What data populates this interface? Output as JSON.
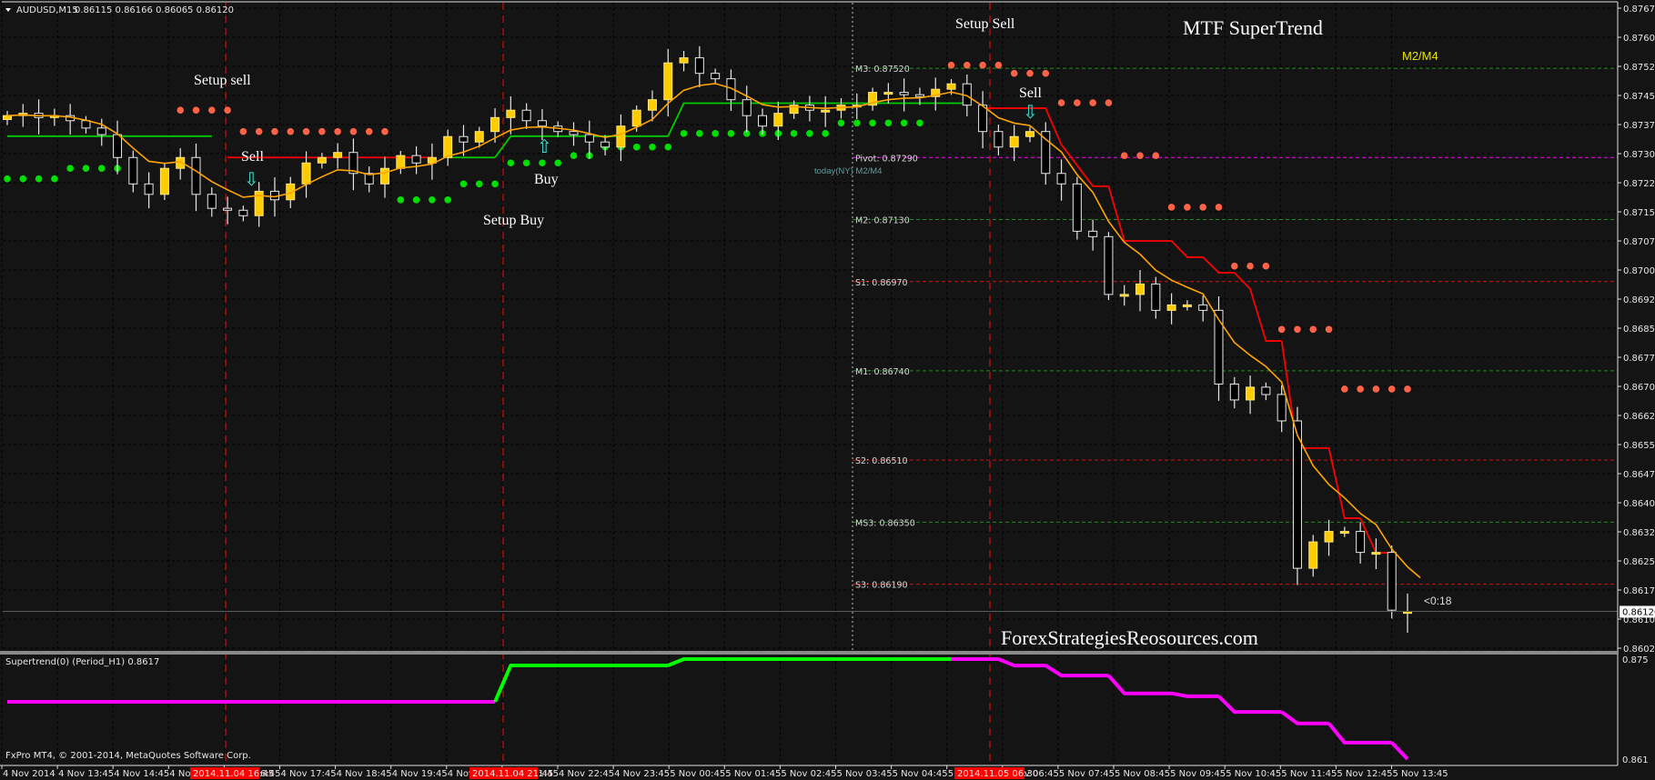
{
  "header": {
    "symbol": "AUDUSD,M15",
    "ohlc": "0.86115 0.86166 0.86065 0.86120"
  },
  "annotations": {
    "setup_sell_1": "Setup sell",
    "sell_1": "Sell",
    "buy_1": "Buy",
    "setup_buy_1": "Setup Buy",
    "setup_sell_2": "Setup Sell",
    "sell_2": "Sell",
    "title": "MTF SuperTrend",
    "m2m4": "M2/M4",
    "today_label": "today(NY) M2/M4",
    "watermark": "ForexStrategiesReosources.com",
    "countdown": "<0:18",
    "copyright": "FxPro MT4, © 2001-2014, MetaQuotes Software Corp."
  },
  "colors": {
    "background": "#141414",
    "bull": "#ffcc00",
    "bear": "#000000",
    "ema": "#ffa500",
    "supertrend_up": "#00cc00",
    "supertrend_down": "#ff0000",
    "dot_up": "#00e000",
    "dot_down": "#ff6347",
    "lower_up": "#00ff00",
    "lower_down": "#ff00ff",
    "arrow": "#40e0d0"
  },
  "price_axis": {
    "labels": [
      "0.87675",
      "0.87600",
      "0.87525",
      "0.87450",
      "0.87375",
      "0.87300",
      "0.87225",
      "0.87150",
      "0.87075",
      "0.87000",
      "0.86925",
      "0.86850",
      "0.86775",
      "0.86700",
      "0.86625",
      "0.86550",
      "0.86475",
      "0.86400",
      "0.86325",
      "0.86250",
      "0.86175",
      "0.86100",
      "0.86025"
    ],
    "current_price": "0.86120"
  },
  "lower_panel": {
    "title": "Supertrend(0) (Period_H1) 0.8617",
    "max_label": "0.875",
    "min_label": "0.861"
  },
  "time_axis": {
    "labels": [
      "4 Nov 2014",
      "4 Nov 13:45",
      "4 Nov 14:45",
      "4 Nov 15:45",
      "4 Nov 16:45",
      "4 Nov 17:45",
      "4 Nov 18:45",
      "4 Nov 19:45",
      "4 Nov 20:45",
      "4 Nov 21:45",
      "4 Nov 22:45",
      "4 Nov 23:45",
      "5 Nov 00:45",
      "5 Nov 01:45",
      "5 Nov 02:45",
      "5 Nov 03:45",
      "5 Nov 04:45",
      "5 Nov 05:45",
      "5 Nov 06:45",
      "5 Nov 07:45",
      "5 Nov 08:45",
      "5 Nov 09:45",
      "5 Nov 10:45",
      "5 Nov 11:45",
      "5 Nov 12:45",
      "5 Nov 13:45"
    ],
    "markers": [
      "2014.11.04 16:45",
      "2014.11.04 21:45",
      "2014.11.05 06:30"
    ]
  },
  "pivots": [
    {
      "label": "M3: 0.87520",
      "value": 0.8752,
      "kind": "m"
    },
    {
      "label": "Pivot: 0.87290",
      "value": 0.8729,
      "kind": "pivot"
    },
    {
      "label": "M2: 0.87130",
      "value": 0.8713,
      "kind": "m"
    },
    {
      "label": "S1: 0.86970",
      "value": 0.8697,
      "kind": "s"
    },
    {
      "label": "M1: 0.86740",
      "value": 0.8674,
      "kind": "m"
    },
    {
      "label": "S2: 0.86510",
      "value": 0.8651,
      "kind": "s"
    },
    {
      "label": "MS3: 0.86350",
      "value": 0.8635,
      "kind": "m"
    },
    {
      "label": "S3: 0.86190",
      "value": 0.8619,
      "kind": "s"
    }
  ],
  "chart_data": {
    "type": "candlestick",
    "title": "AUDUSD,M15",
    "ylim": [
      0.86025,
      0.87675
    ],
    "grid": true,
    "closes": [
      0.87398,
      0.87404,
      0.87393,
      0.87398,
      0.87385,
      0.87366,
      0.87349,
      0.8729,
      0.87222,
      0.87195,
      0.87262,
      0.8729,
      0.87195,
      0.87159,
      0.87154,
      0.8714,
      0.87203,
      0.87181,
      0.87222,
      0.87276,
      0.8729,
      0.87303,
      0.87249,
      0.87222,
      0.87262,
      0.87295,
      0.87276,
      0.8729,
      0.87344,
      0.8733,
      0.87357,
      0.87393,
      0.87412,
      0.87385,
      0.87371,
      0.87357,
      0.87349,
      0.8733,
      0.87317,
      0.87371,
      0.87412,
      0.87439,
      0.87534,
      0.87547,
      0.87507,
      0.87493,
      0.87439,
      0.87398,
      0.87371,
      0.87404,
      0.87425,
      0.87412,
      0.87412,
      0.87425,
      0.87425,
      0.87458,
      0.87458,
      0.87452,
      0.87447,
      0.87466,
      0.8748,
      0.87425,
      0.87357,
      0.87317,
      0.87344,
      0.87357,
      0.87249,
      0.87222,
      0.871,
      0.87086,
      0.86937,
      0.86937,
      0.86964,
      0.86896,
      0.8691,
      0.8691,
      0.86896,
      0.86706,
      0.86665,
      0.86698,
      0.86679,
      0.86611,
      0.86231,
      0.86299,
      0.86326,
      0.86326,
      0.86272,
      0.86272,
      0.86123,
      0.8612
    ],
    "last_bar": {
      "open": 0.86115,
      "high": 0.86166,
      "low": 0.86065,
      "close": 0.8612
    },
    "supertrend": [
      {
        "trend": "up",
        "from": 0,
        "to": 13,
        "value": 0.87345
      },
      {
        "trend": "down",
        "from": 14,
        "to": 27,
        "value": 0.8729
      },
      {
        "trend": "up",
        "from": 28,
        "to": 31,
        "value": 0.8729
      },
      {
        "trend": "up",
        "from": 32,
        "to": 42,
        "value": 0.87345
      },
      {
        "trend": "up",
        "from": 43,
        "to": 61,
        "value": 0.8743
      },
      {
        "trend": "down",
        "from": 62,
        "to": 66,
        "value": 0.87417
      },
      {
        "trend": "down",
        "from": 67,
        "to": 67,
        "value": 0.87323
      },
      {
        "trend": "down",
        "from": 68,
        "to": 68,
        "value": 0.8727
      },
      {
        "trend": "down",
        "from": 69,
        "to": 70,
        "value": 0.87216
      },
      {
        "trend": "down",
        "from": 71,
        "to": 74,
        "value": 0.87075
      },
      {
        "trend": "down",
        "from": 75,
        "to": 76,
        "value": 0.87033
      },
      {
        "trend": "down",
        "from": 77,
        "to": 78,
        "value": 0.86993
      },
      {
        "trend": "down",
        "from": 79,
        "to": 79,
        "value": 0.86951
      },
      {
        "trend": "down",
        "from": 80,
        "to": 81,
        "value": 0.86817
      },
      {
        "trend": "down",
        "from": 82,
        "to": 84,
        "value": 0.86541
      },
      {
        "trend": "down",
        "from": 85,
        "to": 86,
        "value": 0.8636
      },
      {
        "trend": "down",
        "from": 87,
        "to": 88,
        "value": 0.86271
      }
    ],
    "dots": [
      {
        "trend": "up",
        "from": 0,
        "to": 3,
        "value": 0.87235
      },
      {
        "trend": "up",
        "from": 4,
        "to": 7,
        "value": 0.87262
      },
      {
        "trend": "down",
        "from": 11,
        "to": 14,
        "value": 0.87412
      },
      {
        "trend": "down",
        "from": 15,
        "to": 17,
        "value": 0.87357
      },
      {
        "trend": "down",
        "from": 18,
        "to": 24,
        "value": 0.87357
      },
      {
        "trend": "up",
        "from": 25,
        "to": 28,
        "value": 0.87181
      },
      {
        "trend": "up",
        "from": 29,
        "to": 31,
        "value": 0.87222
      },
      {
        "trend": "up",
        "from": 32,
        "to": 35,
        "value": 0.87276
      },
      {
        "trend": "up",
        "from": 36,
        "to": 37,
        "value": 0.87295
      },
      {
        "trend": "up",
        "from": 38,
        "to": 42,
        "value": 0.87317
      },
      {
        "trend": "up",
        "from": 43,
        "to": 52,
        "value": 0.87352
      },
      {
        "trend": "up",
        "from": 53,
        "to": 58,
        "value": 0.87379
      },
      {
        "trend": "down",
        "from": 60,
        "to": 63,
        "value": 0.87528
      },
      {
        "trend": "down",
        "from": 64,
        "to": 66,
        "value": 0.87507
      },
      {
        "trend": "down",
        "from": 67,
        "to": 70,
        "value": 0.87431
      },
      {
        "trend": "down",
        "from": 71,
        "to": 73,
        "value": 0.87295
      },
      {
        "trend": "down",
        "from": 74,
        "to": 77,
        "value": 0.87162
      },
      {
        "trend": "down",
        "from": 78,
        "to": 80,
        "value": 0.8701
      },
      {
        "trend": "down",
        "from": 81,
        "to": 84,
        "value": 0.86847
      },
      {
        "trend": "down",
        "from": 85,
        "to": 89,
        "value": 0.86693
      }
    ],
    "lower_ylim": [
      0.861,
      0.875
    ],
    "lower_series": [
      {
        "trend": "down",
        "from": 0,
        "to": 31,
        "value": 0.86902
      },
      {
        "trend": "up",
        "from": 32,
        "to": 42,
        "value": 0.87411
      },
      {
        "trend": "up",
        "from": 43,
        "to": 60,
        "value": 0.875
      },
      {
        "trend": "down",
        "from": 61,
        "to": 63,
        "value": 0.875
      },
      {
        "trend": "down",
        "from": 64,
        "to": 66,
        "value": 0.8741
      },
      {
        "trend": "down",
        "from": 67,
        "to": 70,
        "value": 0.8727
      },
      {
        "trend": "down",
        "from": 71,
        "to": 74,
        "value": 0.8702
      },
      {
        "trend": "down",
        "from": 75,
        "to": 77,
        "value": 0.8698
      },
      {
        "trend": "down",
        "from": 78,
        "to": 81,
        "value": 0.8676
      },
      {
        "trend": "down",
        "from": 82,
        "to": 84,
        "value": 0.866
      },
      {
        "trend": "down",
        "from": 85,
        "to": 88,
        "value": 0.8633
      },
      {
        "trend": "down",
        "from": 89,
        "to": 89,
        "value": 0.861
      }
    ],
    "signals": [
      {
        "type": "sell",
        "bar": 15
      },
      {
        "type": "buy",
        "bar": 34
      },
      {
        "type": "sell",
        "bar": 65
      }
    ]
  }
}
